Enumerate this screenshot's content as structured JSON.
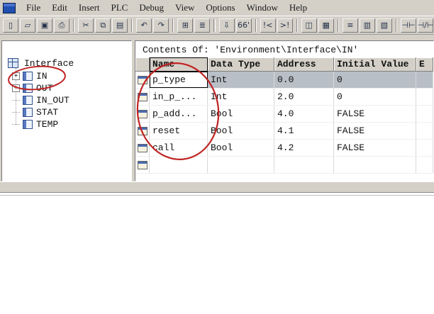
{
  "menu": {
    "items": [
      "File",
      "Edit",
      "Insert",
      "PLC",
      "Debug",
      "View",
      "Options",
      "Window",
      "Help"
    ]
  },
  "toolbar": {
    "buttons": [
      {
        "name": "new-button",
        "glyph": "▯"
      },
      {
        "name": "open-button",
        "glyph": "▱"
      },
      {
        "name": "save-button",
        "glyph": "▣"
      },
      {
        "name": "print-button",
        "glyph": "⎙"
      },
      {
        "sep": true
      },
      {
        "name": "cut-button",
        "glyph": "✂"
      },
      {
        "name": "copy-button",
        "glyph": "⧉"
      },
      {
        "name": "paste-button",
        "glyph": "▤"
      },
      {
        "sep": true
      },
      {
        "name": "undo-button",
        "glyph": "↶"
      },
      {
        "name": "redo-button",
        "glyph": "↷"
      },
      {
        "sep": true
      },
      {
        "name": "program-elements-button",
        "glyph": "⊞"
      },
      {
        "name": "network-toggle-button",
        "glyph": "≣"
      },
      {
        "sep": true
      },
      {
        "name": "download-button",
        "glyph": "⇩"
      },
      {
        "name": "monitor-button",
        "glyph": "66'"
      },
      {
        "sep": true
      },
      {
        "name": "goto-prev-error-button",
        "glyph": "!<"
      },
      {
        "name": "goto-next-error-button",
        "glyph": ">!"
      },
      {
        "sep": true
      },
      {
        "name": "overview-button",
        "glyph": "◫"
      },
      {
        "name": "detail-view-button",
        "glyph": "▦"
      },
      {
        "sep": true
      },
      {
        "name": "new-network-button",
        "glyph": "≡"
      },
      {
        "name": "symbol-info-button",
        "glyph": "▥"
      },
      {
        "name": "comment-toggle-button",
        "glyph": "▧"
      },
      {
        "sep": true
      },
      {
        "name": "contact-no-button",
        "glyph": "⊣⊢"
      },
      {
        "name": "contact-nc-button",
        "glyph": "⊣/⊢"
      }
    ]
  },
  "tree": {
    "root_label": "Interface",
    "expander_glyph": "+",
    "items": [
      {
        "label": "IN",
        "expandable": true
      },
      {
        "label": "OUT",
        "expandable": true
      },
      {
        "label": "IN_OUT",
        "expandable": false
      },
      {
        "label": "STAT",
        "expandable": false
      },
      {
        "label": "TEMP",
        "expandable": false
      }
    ]
  },
  "contents": {
    "title": "Contents Of: 'Environment\\Interface\\IN'",
    "table": {
      "columns": [
        "Name",
        "Data Type",
        "Address",
        "Initial Value"
      ],
      "clipped_column": "E",
      "rows": [
        {
          "name": "p_type",
          "data_type": "Int",
          "address": "0.0",
          "initial_value": "0",
          "editing": true
        },
        {
          "name": "in_p_...",
          "data_type": "Int",
          "address": "2.0",
          "initial_value": "0"
        },
        {
          "name": "p_add...",
          "data_type": "Bool",
          "address": "4.0",
          "initial_value": "FALSE"
        },
        {
          "name": "reset",
          "data_type": "Bool",
          "address": "4.1",
          "initial_value": "FALSE"
        },
        {
          "name": "call",
          "data_type": "Bool",
          "address": "4.2",
          "initial_value": "FALSE"
        }
      ],
      "has_placeholder_row": true
    }
  },
  "annotations": {
    "color": "#c02424",
    "items": [
      "hand-drawn circle around IN tree item",
      "hand-drawn circle around Name column values"
    ]
  }
}
